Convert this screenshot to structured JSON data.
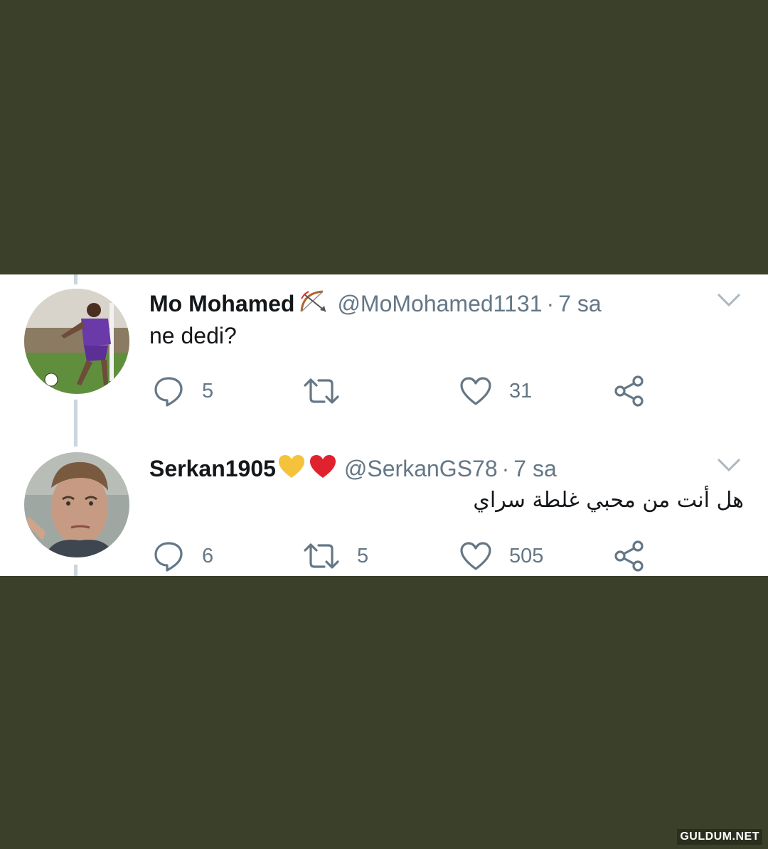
{
  "tweets": [
    {
      "name": "Mo Mohamed",
      "handle": "@MoMohamed1131",
      "time": "7 sa",
      "text": "ne dedi?",
      "emoji_icons": [
        "bow-and-arrow-icon"
      ],
      "replies": "5",
      "retweets": "",
      "likes": "31"
    },
    {
      "name": "Serkan1905",
      "handle": "@SerkanGS78",
      "time": "7 sa",
      "text": "هل أنت من محبي غلطة سراي",
      "emoji_icons": [
        "yellow-heart-icon",
        "red-heart-icon"
      ],
      "replies": "6",
      "retweets": "5",
      "likes": "505"
    }
  ],
  "separator": "·",
  "watermark": "GULDUM.NET",
  "colors": {
    "background": "#3b402a",
    "panel": "#ffffff",
    "muted": "#657786",
    "text": "#14171a",
    "thread": "#c9d6df"
  }
}
